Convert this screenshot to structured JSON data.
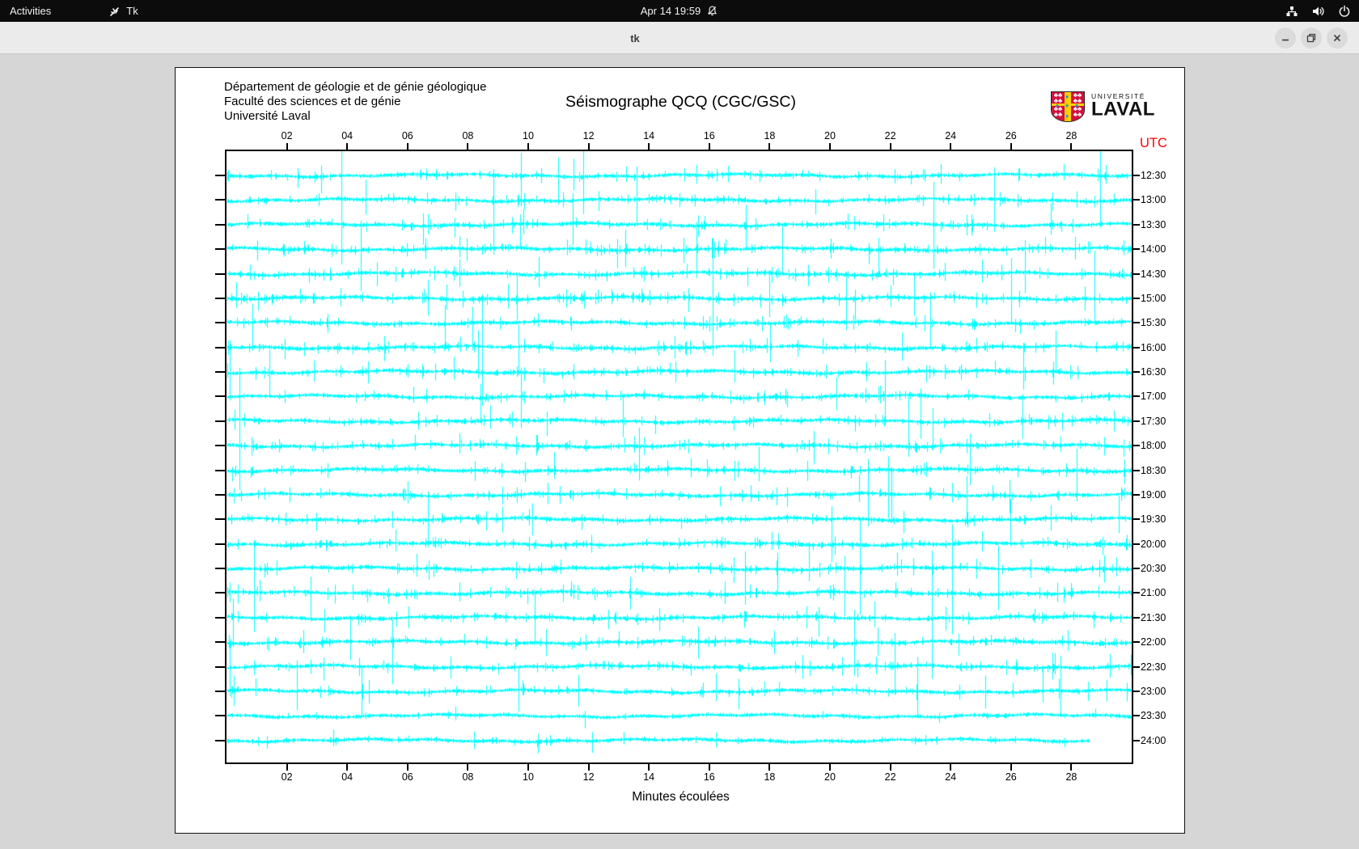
{
  "topbar": {
    "activities_label": "Activities",
    "app_label": "Tk",
    "clock": "Apr 14 19:59",
    "icons": [
      "tk-icon",
      "notifications-disabled-icon",
      "network-wired-icon",
      "volume-icon",
      "power-icon"
    ]
  },
  "titlebar": {
    "title": "tk",
    "buttons": [
      "minimize",
      "maximize",
      "close"
    ]
  },
  "seismograph": {
    "institution_lines": [
      "Département de géologie et de génie géologique",
      "Faculté des sciences et de génie",
      "Université Laval"
    ],
    "title": "Séismographe QCQ (CGC/GSC)",
    "logo": {
      "line1": "UNIVERSITÉ",
      "line2": "LAVAL"
    },
    "utc_label": "UTC",
    "utc_color": "#ff0000",
    "xaxis_title": "Minutes écoulées",
    "trace_color": "#00ffff"
  },
  "chart_data": {
    "type": "line",
    "subtype": "helicorder-seismogram",
    "title": "Séismographe QCQ (CGC/GSC)",
    "xlabel": "Minutes écoulées",
    "ylabel": "UTC",
    "x_range_minutes": [
      0,
      30
    ],
    "x_ticks": [
      "02",
      "04",
      "06",
      "08",
      "10",
      "12",
      "14",
      "16",
      "18",
      "20",
      "22",
      "24",
      "26",
      "28"
    ],
    "rows": [
      "12:30",
      "13:00",
      "13:30",
      "14:00",
      "14:30",
      "15:00",
      "15:30",
      "16:00",
      "16:30",
      "17:00",
      "17:30",
      "18:00",
      "18:30",
      "19:00",
      "19:30",
      "20:00",
      "20:30",
      "21:00",
      "21:30",
      "22:00",
      "22:30",
      "23:00",
      "23:30",
      "24:00"
    ],
    "row_activity": [
      0.8,
      1.0,
      1.0,
      1.1,
      1.1,
      1.2,
      0.9,
      1.0,
      0.9,
      0.9,
      1.0,
      1.0,
      0.9,
      1.0,
      0.9,
      1.0,
      0.8,
      0.9,
      0.9,
      0.9,
      0.8,
      0.7,
      0.18,
      0.45
    ],
    "last_row_end_minute": 28.6,
    "grid": false,
    "legend": null,
    "note": "Continuous seismic noise traces; values are stochastic waveform noise with sporadic spikes, one 30-minute trace per half-hour UTC row."
  }
}
